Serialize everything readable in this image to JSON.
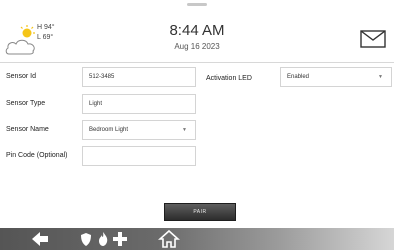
{
  "header": {
    "weather": {
      "icon": "partly-cloudy-icon",
      "high": "H 94°",
      "low": "L 69°"
    },
    "time": "8:44 AM",
    "date": "Aug 16 2023",
    "message_icon": "mail-icon"
  },
  "form": {
    "sensor_id": {
      "label": "Sensor Id",
      "value": "512-3485"
    },
    "sensor_type": {
      "label": "Sensor Type",
      "value": "Light"
    },
    "sensor_name": {
      "label": "Sensor Name",
      "value": "Bedroom Light"
    },
    "pin_code": {
      "label": "Pin Code (Optional)",
      "value": ""
    },
    "activation_led": {
      "label": "Activation LED",
      "value": "Enabled"
    }
  },
  "pair_button": {
    "label": "PAIR"
  },
  "nav": {
    "back_icon": "back-arrow-icon",
    "emergency_icons": [
      "police-shield-icon",
      "fire-icon",
      "medical-cross-icon"
    ],
    "home_icon": "home-icon"
  },
  "colors": {
    "nav_bar": "#5a5a5a",
    "button": "#3a3a3a",
    "field_border": "#d4d4d4"
  }
}
